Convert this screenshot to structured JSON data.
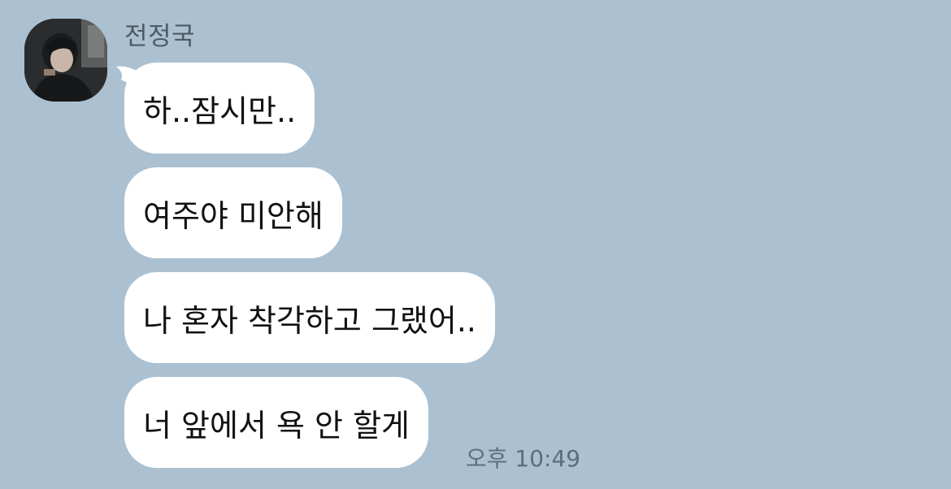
{
  "chat": {
    "sender_name": "전정국",
    "avatar_icon": "profile-photo",
    "background_color": "#abc1d2",
    "messages": [
      {
        "text": "하..잠시만.."
      },
      {
        "text": "여주야 미안해"
      },
      {
        "text": "나 혼자 착각하고 그랬어.."
      },
      {
        "text": "너 앞에서 욕 안 할게"
      }
    ],
    "timestamp": "오후 10:49"
  }
}
